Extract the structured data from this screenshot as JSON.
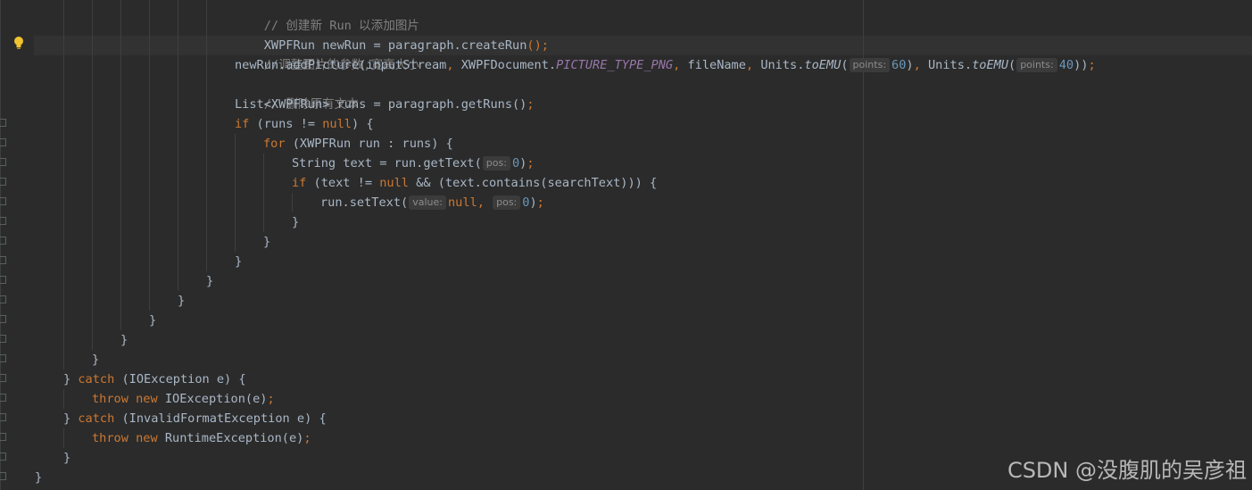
{
  "code": {
    "l1_comment": "// 创建新 Run 以添加图片",
    "l2": "XWPFRun newRun = paragraph.createRun",
    "l2_tail": "();",
    "l3_comment": "//调整图片的参数,宽高大小",
    "l4_a": "newRun.addPicture(inputStream",
    "l4_b": "XWPFDocument.",
    "l4_const": "PICTURE_TYPE_PNG",
    "l4_c": "fileName",
    "l4_d": "Units.",
    "l4_meth": "toEMU",
    "l4_hint": "points:",
    "l4_num1": "60",
    "l4_num2": "40",
    "l5_comment": "// 删除原有文本",
    "l6": "List<XWPFRun> runs = paragraph.getRuns",
    "l7_kw": "if",
    "l7": " (runs != ",
    "l7_null": "null",
    "l7_end": ") {",
    "l8_kw": "for",
    "l8": " (XWPFRun run : runs) {",
    "l9": "String text = run.getText(",
    "l9_hint": "pos:",
    "l9_num": "0",
    "l10_kw": "if",
    "l10_a": " (text != ",
    "l10_null": "null",
    "l10_b": " && (text.contains(searchText))) {",
    "l11": "run.setText(",
    "l11_hint1": "value:",
    "l11_null": "null",
    "l11_hint2": "pos:",
    "l11_num": "0",
    "brace": "}",
    "catch1_kw": "catch",
    "catch1": " (IOException e) {",
    "throw_kw": "throw",
    "new_kw": "new",
    "throw1": " IOException(e)",
    "catch2": " (InvalidFormatException e) {",
    "throw2": " RuntimeException(e)",
    "semi": ";",
    "comma": ","
  },
  "watermark": "CSDN @没腹肌的吴彦祖",
  "colors": {
    "background": "#2b2b2b",
    "keyword": "#cc7832",
    "comment": "#808080",
    "constant": "#9876aa",
    "number": "#6897bb",
    "text": "#a9b7c6"
  }
}
